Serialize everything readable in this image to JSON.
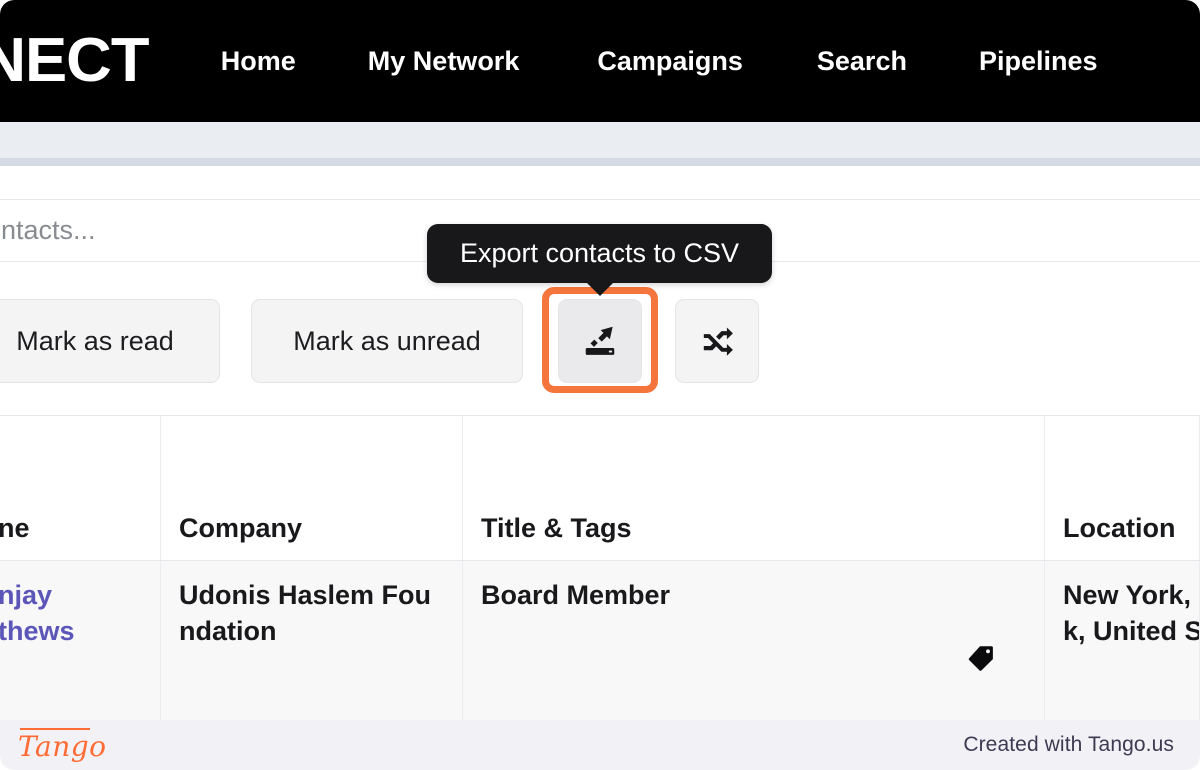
{
  "nav": {
    "brand": "NECT",
    "links": [
      {
        "label": "Home"
      },
      {
        "label": "My Network"
      },
      {
        "label": "Campaigns"
      },
      {
        "label": "Search"
      },
      {
        "label": "Pipelines"
      }
    ]
  },
  "search": {
    "placeholder": "ontacts...",
    "value": ""
  },
  "toolbar": {
    "mark_read_label": "Mark as read",
    "mark_unread_label": "Mark as unread",
    "export_icon": "export-csv-icon",
    "shuffle_icon": "shuffle-icon"
  },
  "tooltip": {
    "text": "Export contacts to CSV"
  },
  "highlight": {
    "color": "#f4763c"
  },
  "table": {
    "columns": [
      {
        "label": "ne"
      },
      {
        "label": "Company"
      },
      {
        "label": "Title & Tags"
      },
      {
        "label": "Location"
      }
    ],
    "rows": [
      {
        "name": "njay",
        "name_line2": "thews",
        "company": "Udonis Haslem Fou",
        "company_line2": "ndation",
        "title": "Board Member",
        "tag_icon": "tag-icon",
        "location": "New York,",
        "location_line2": "k, United S"
      }
    ]
  },
  "footer": {
    "logo": "Tango",
    "credit": "Created with Tango.us"
  },
  "colors": {
    "nav_background": "#000000",
    "link": "#5b56b8",
    "highlight": "#f4763c",
    "tooltip_background": "#18181b",
    "tango_orange": "#ff6b35"
  }
}
